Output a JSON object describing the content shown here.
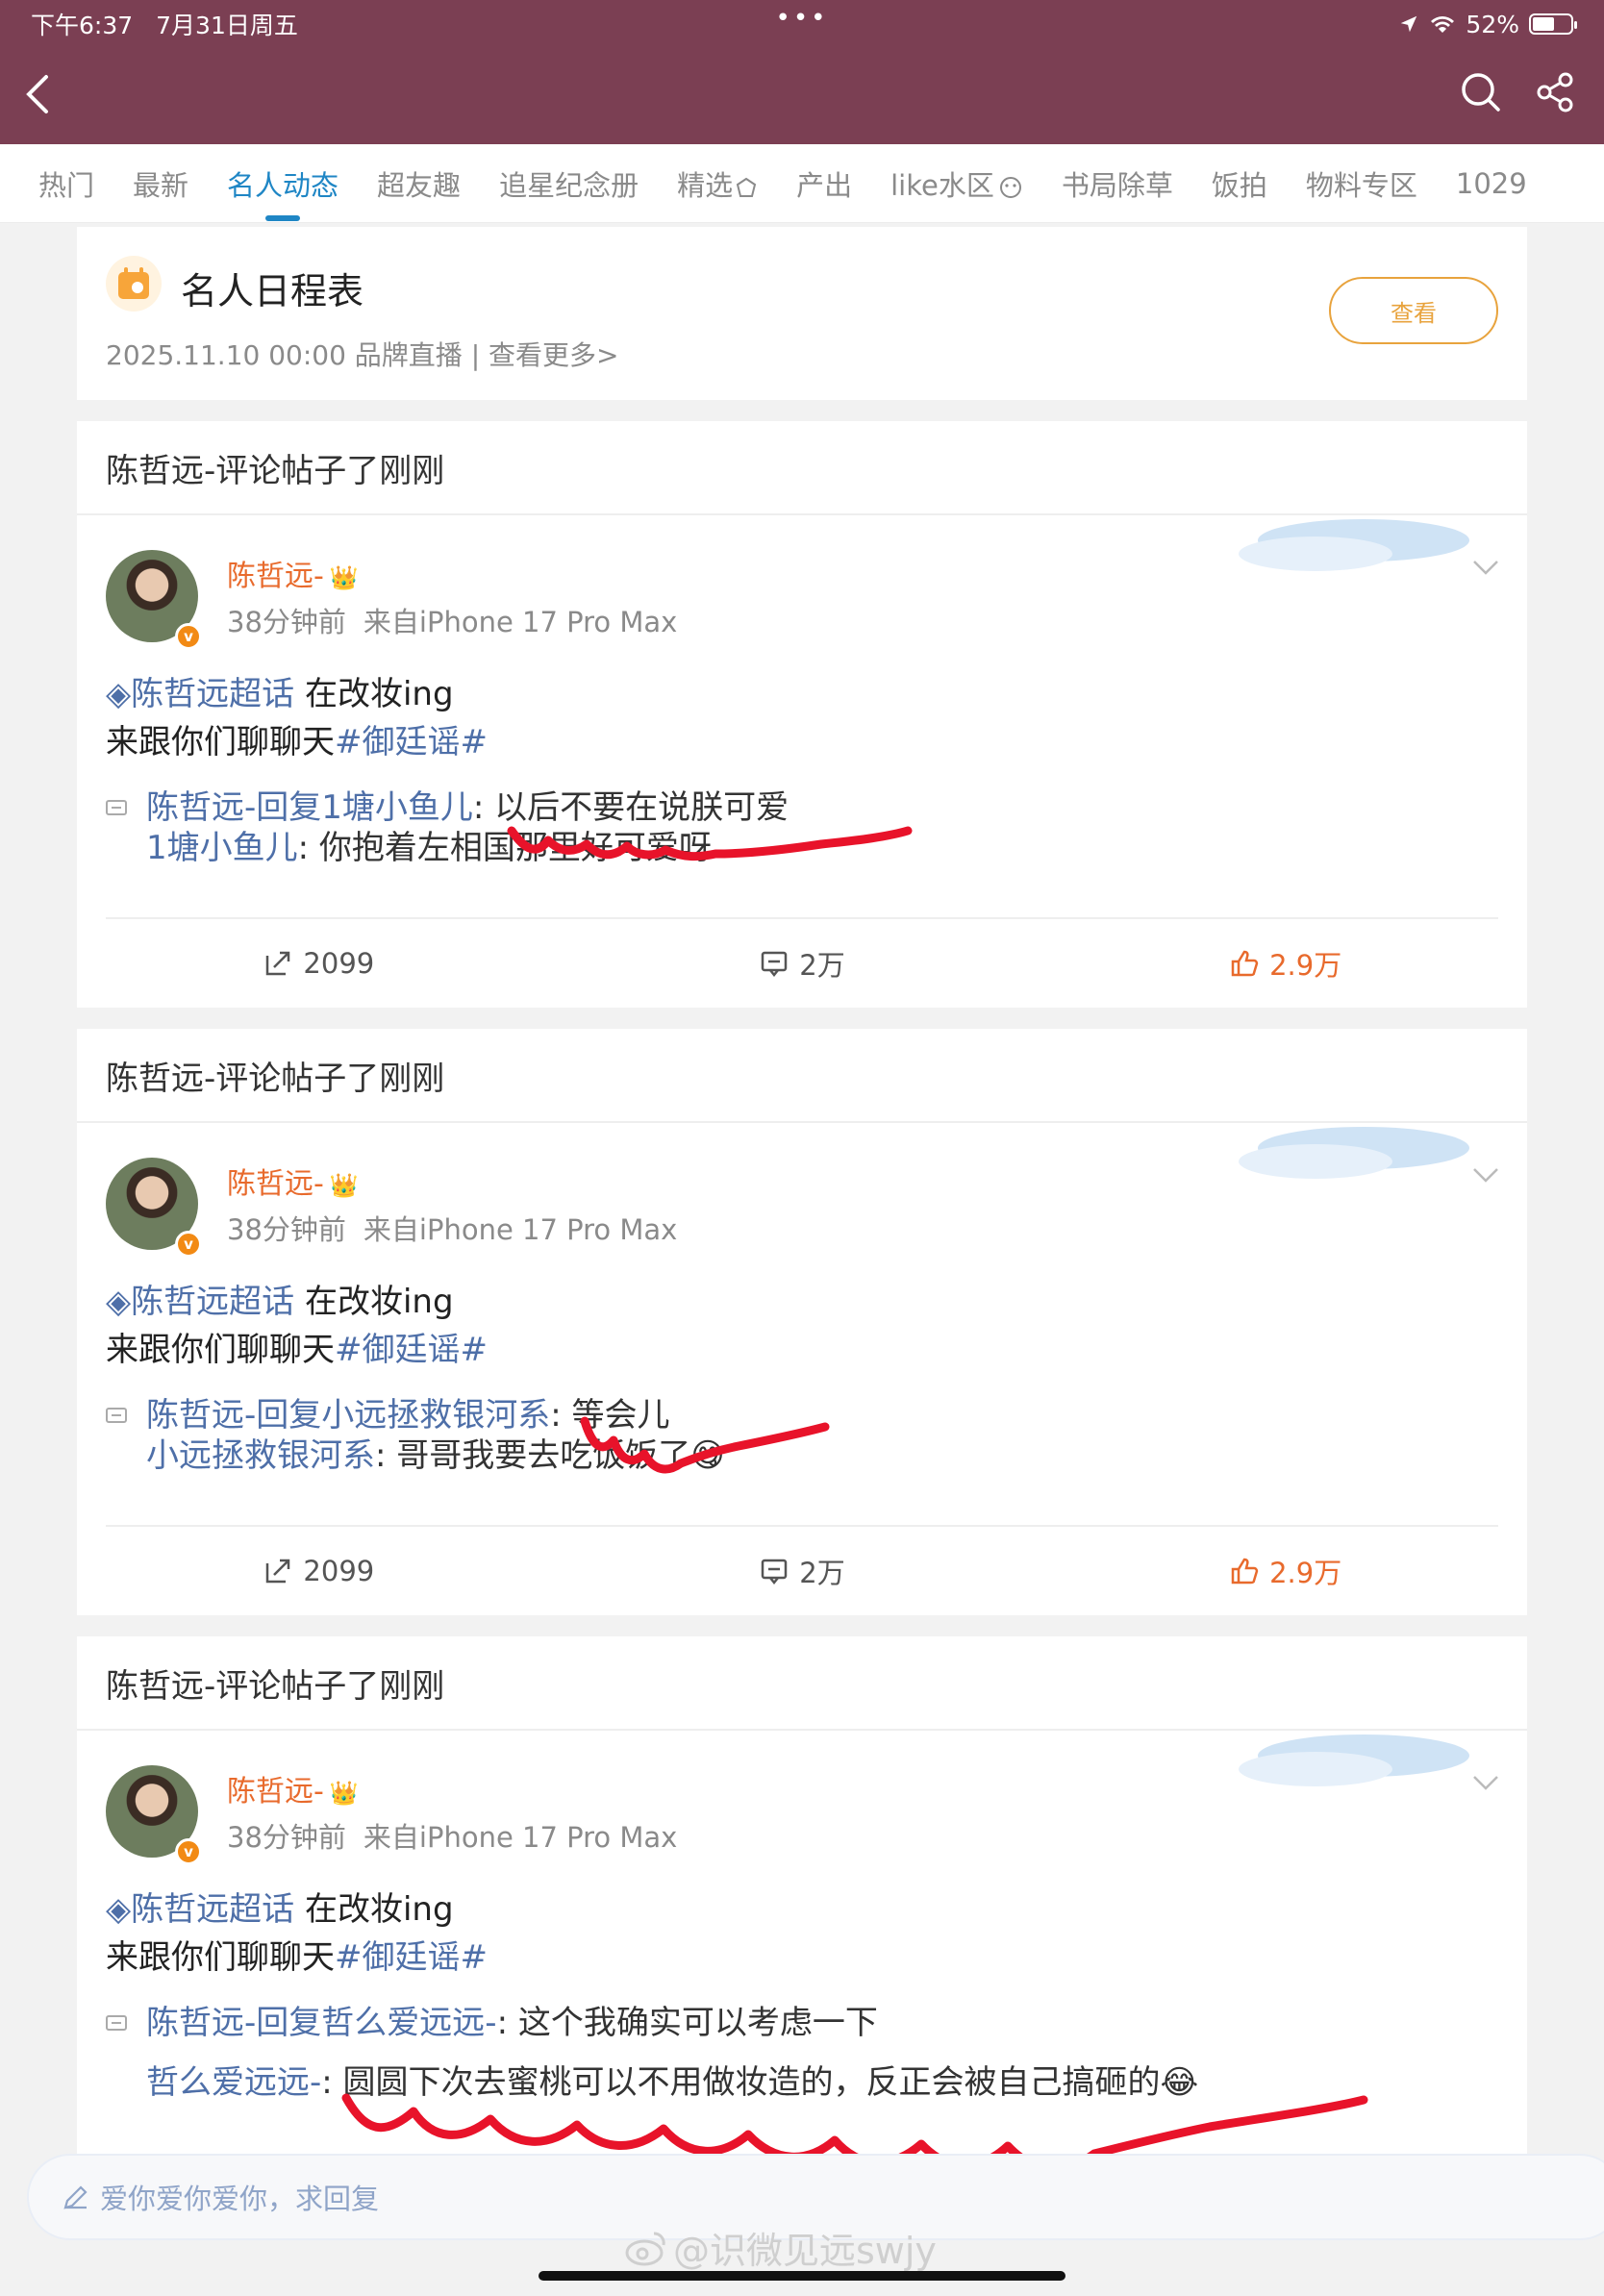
{
  "status_bar": {
    "time": "下午6:37",
    "date": "7月31日周五",
    "dots": "•••",
    "battery": "52%"
  },
  "header": {
    "back_icon": "chevron-left-icon",
    "search_icon": "search-icon",
    "share_icon": "share-icon"
  },
  "tabs": [
    {
      "label": "热门"
    },
    {
      "label": "最新"
    },
    {
      "label": "名人动态",
      "active": true
    },
    {
      "label": "超友趣"
    },
    {
      "label": "追星纪念册"
    },
    {
      "label": "精选"
    },
    {
      "label": "产出"
    },
    {
      "label": "like水区"
    },
    {
      "label": "书局除草"
    },
    {
      "label": "饭拍"
    },
    {
      "label": "物料专区"
    },
    {
      "label": "1029"
    }
  ],
  "schedule": {
    "title": "名人日程表",
    "subtitle": "2025.11.10 00:00 品牌直播 | 查看更多>",
    "button": "查看"
  },
  "posts": [
    {
      "header": "陈哲远-评论帖子了刚刚",
      "author": "陈哲远-",
      "time": "38分钟前",
      "source": "来自iPhone 17 Pro Max",
      "topic": "◈陈哲远超话",
      "line1_rest": " 在改妆ing",
      "line2_text": "来跟你们聊聊天",
      "hashtag": "#御廷谣#",
      "reply_prefix": "陈哲远-回复",
      "reply_to": "1塘小鱼儿",
      "reply_text": ": 以后不要在说朕可爱",
      "orig_user": "1塘小鱼儿",
      "orig_text": ": 你抱着左相国那里好可爱呀",
      "reposts": "2099",
      "comments": "2万",
      "likes": "2.9万"
    },
    {
      "header": "陈哲远-评论帖子了刚刚",
      "author": "陈哲远-",
      "time": "38分钟前",
      "source": "来自iPhone 17 Pro Max",
      "topic": "◈陈哲远超话",
      "line1_rest": " 在改妆ing",
      "line2_text": "来跟你们聊聊天",
      "hashtag": "#御廷谣#",
      "reply_prefix": "陈哲远-回复",
      "reply_to": "小远拯救银河系",
      "reply_text": ": 等会儿",
      "orig_user": "小远拯救银河系",
      "orig_text": ": 哥哥我要去吃饭饭了😋",
      "reposts": "2099",
      "comments": "2万",
      "likes": "2.9万"
    },
    {
      "header": "陈哲远-评论帖子了刚刚",
      "author": "陈哲远-",
      "time": "38分钟前",
      "source": "来自iPhone 17 Pro Max",
      "topic": "◈陈哲远超话",
      "line1_rest": " 在改妆ing",
      "line2_text": "来跟你们聊聊天",
      "hashtag": "#御廷谣#",
      "reply_prefix": "陈哲远-回复",
      "reply_to": "哲么爱远远-",
      "reply_text": ": 这个我确实可以考虑一下",
      "orig_user": "哲么爱远远-",
      "orig_text": ": 圆圆下次去蜜桃可以不用做妆造的，反正会被自己搞砸的😂",
      "reposts": "",
      "comments": "",
      "likes": ""
    }
  ],
  "input": {
    "placeholder": "爱你爱你爱你，求回复"
  },
  "watermark": "@识微见远swjy",
  "colors": {
    "header_bg": "#7b3f53",
    "accent": "#1f86c5",
    "link": "#4e6fa8",
    "orange": "#e86a2c",
    "scribble": "#e8132a"
  }
}
